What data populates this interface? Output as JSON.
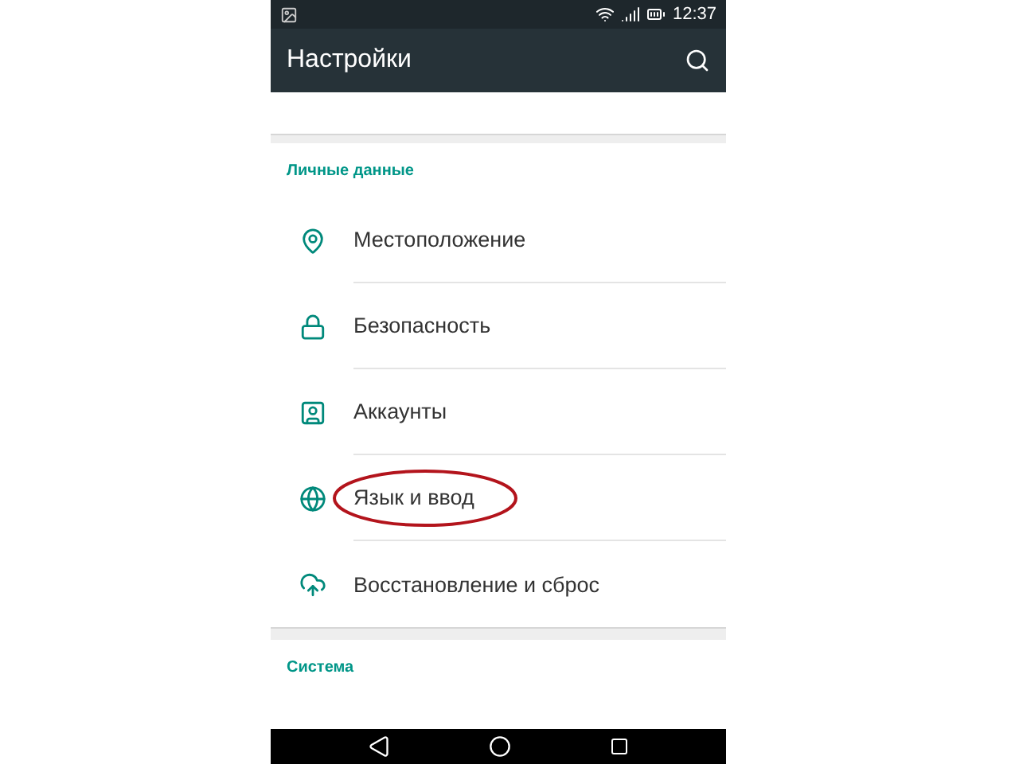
{
  "status_bar": {
    "time": "12:37"
  },
  "toolbar": {
    "title": "Настройки"
  },
  "sections": [
    {
      "header": "Личные данные",
      "items": [
        {
          "label": "Местоположение",
          "circled": false
        },
        {
          "label": "Безопасность",
          "circled": false
        },
        {
          "label": "Аккаунты",
          "circled": false
        },
        {
          "label": "Язык и ввод",
          "circled": true
        },
        {
          "label": "Восстановление и сброс",
          "circled": false
        }
      ]
    },
    {
      "header": "Система"
    }
  ]
}
